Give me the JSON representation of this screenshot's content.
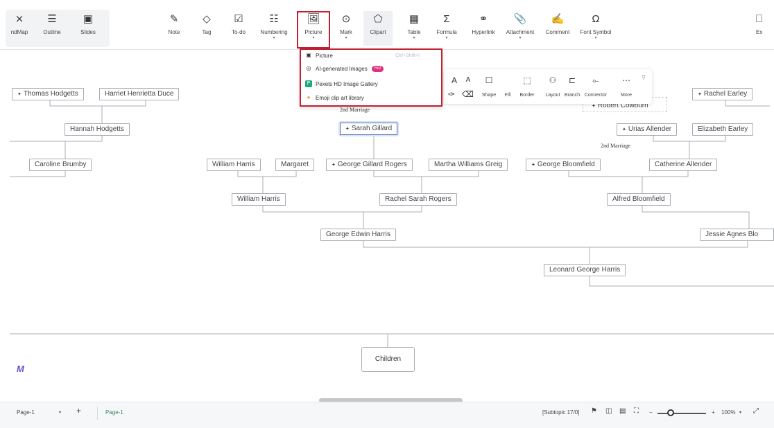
{
  "toolbar": {
    "view_tabs": [
      {
        "label": "ndMap",
        "icon": "mindmap-icon"
      },
      {
        "label": "Outline",
        "icon": "outline-icon"
      },
      {
        "label": "Slides",
        "icon": "slides-icon"
      }
    ],
    "tools": [
      {
        "label": "Note",
        "icon": "note-icon"
      },
      {
        "label": "Tag",
        "icon": "tag-icon"
      },
      {
        "label": "To-do",
        "icon": "todo-icon"
      },
      {
        "label": "Numbering",
        "icon": "numbering-icon"
      },
      {
        "label": "Picture",
        "icon": "picture-icon"
      },
      {
        "label": "Mark",
        "icon": "mark-icon"
      },
      {
        "label": "Clipart",
        "icon": "clipart-icon"
      },
      {
        "label": "Table",
        "icon": "table-icon"
      },
      {
        "label": "Formula",
        "icon": "formula-icon"
      },
      {
        "label": "Hyperlink",
        "icon": "hyperlink-icon"
      },
      {
        "label": "Attachment",
        "icon": "attachment-icon"
      },
      {
        "label": "Comment",
        "icon": "comment-icon"
      },
      {
        "label": "Font Symbol",
        "icon": "font-symbol-icon"
      },
      {
        "label": "Ex",
        "icon": "export-icon"
      }
    ],
    "highlight_color": "#c0202f"
  },
  "picture_menu": {
    "items": [
      {
        "label": "Picture",
        "shortcut": "Ctrl+Shift+I",
        "icon": "image-icon"
      },
      {
        "label": "AI-generated Images",
        "badge": "Hot",
        "icon": "ai-image-icon"
      },
      {
        "label": "Pexels HD Image Gallery",
        "icon": "pexels-icon"
      },
      {
        "label": "Emoji clip art library",
        "icon": "emoji-icon"
      }
    ]
  },
  "float_bar": {
    "font_grow": "A",
    "font_shrink": "A",
    "buttons": [
      "Shape",
      "Fill",
      "Border",
      "Layout",
      "Branch",
      "Connector",
      "More"
    ]
  },
  "tree": {
    "nodes": {
      "thomas_hodgetts": "Thomas Hodgetts",
      "harriet_duce": "Harriet Henrietta Duce",
      "hannah_hodgetts": "Hannah Hodgetts",
      "caroline_brumby": "Caroline Brumby",
      "sarah_gillard": "Sarah Gillard",
      "william_harris_1": "William Harris",
      "margaret": "Margaret",
      "george_gillard_rogers": "George Gillard Rogers",
      "martha_williams_greig": "Martha Williams Greig",
      "george_bloomfield": "George Bloomfield",
      "william_harris_2": "William Harris",
      "rachel_sarah_rogers": "Rachel Sarah Rogers",
      "alfred_bloomfield": "Alfred Bloomfield",
      "george_edwin_harris": "George Edwin Harris",
      "leonard_george_harris": "Leonard George Harris",
      "robert_cowburn": "Robert Cowburn",
      "rachel_earley": "Rachel Earley",
      "urias_allender": "Urias Allender",
      "elizabeth_earley": "Elizabeth Earley",
      "catherine_allender": "Catherine Allender",
      "jessie_agnes": "Jessie Agnes Blo"
    },
    "relations": {
      "second_marriage_1": "2nd Marriage",
      "second_marriage_2": "2nd Marriage"
    },
    "children_label": "Children"
  },
  "statusbar": {
    "page_select": "Page-1",
    "add": "+",
    "page_tab": "Page-1",
    "subtopic_count": "[Subtopic 17/0]",
    "zoom_minus": "−",
    "zoom_plus": "+",
    "zoom": "100%"
  },
  "colors": {
    "accent_blue": "#5170b5",
    "page_tab_green": "#2e8b57"
  }
}
